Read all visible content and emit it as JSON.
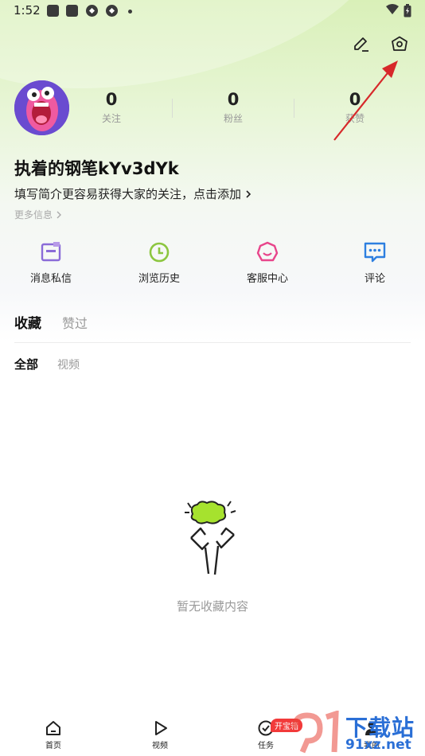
{
  "status_bar": {
    "time": "1:52",
    "icons": [
      "notification-icon",
      "notification-icon",
      "app-icon",
      "app-icon",
      "more-dot-icon"
    ],
    "right_icons": [
      "wifi-icon",
      "battery-icon"
    ]
  },
  "header_actions": {
    "edit_icon": "edit-icon",
    "settings_icon": "settings-icon"
  },
  "profile": {
    "stats": [
      {
        "value": "0",
        "label": "关注"
      },
      {
        "value": "0",
        "label": "粉丝"
      },
      {
        "value": "0",
        "label": "获赞"
      }
    ],
    "nickname": "执着的钢笔kYv3dYk",
    "bio": "填写简介更容易获得大家的关注，点击添加",
    "more_info": "更多信息"
  },
  "quick_actions": [
    {
      "label": "消息私信",
      "icon": "message-icon",
      "color": "#8a6bd8"
    },
    {
      "label": "浏览历史",
      "icon": "clock-icon",
      "color": "#8cc63f"
    },
    {
      "label": "客服中心",
      "icon": "customer-service-icon",
      "color": "#e8458b"
    },
    {
      "label": "评论",
      "icon": "comment-icon",
      "color": "#2d7fe0"
    }
  ],
  "tabs": {
    "active": "收藏",
    "other": "赞过"
  },
  "subtabs": {
    "active": "全部",
    "other": "视频"
  },
  "empty_state": {
    "text": "暂无收藏内容",
    "illustration": "empty-illustration-icon"
  },
  "bottom_nav": [
    {
      "label": "首页",
      "icon": "home-icon"
    },
    {
      "label": "视频",
      "icon": "play-icon"
    },
    {
      "label": "任务",
      "icon": "task-icon",
      "badge": "开宝箱"
    },
    {
      "label": "我的",
      "icon": "profile-icon"
    }
  ],
  "watermark": {
    "title": "下载站",
    "url": "91xz.net"
  },
  "colors": {
    "accent_green": "#8cc63f",
    "annotation_red": "#d7282a",
    "badge_red": "#f23a3a"
  }
}
